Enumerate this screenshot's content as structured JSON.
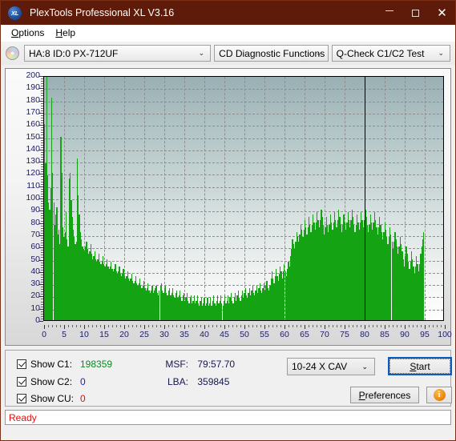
{
  "window": {
    "title": "PlexTools Professional XL V3.16",
    "app_icon": "xl-logo-icon",
    "minimize_label": "─",
    "maximize_label": "□",
    "close_label": "✕"
  },
  "menubar": {
    "items": [
      {
        "label": "Options",
        "accel": "O"
      },
      {
        "label": "Help",
        "accel": "H"
      }
    ]
  },
  "toolbar": {
    "disc_icon": "disc-icon",
    "drive_select": {
      "value": "HA:8 ID:0  PX-712UF",
      "arrow": "⌄"
    },
    "function_select": {
      "value": "CD Diagnostic Functions",
      "arrow": "⌄"
    },
    "test_select": {
      "value": "Q-Check C1/C2 Test",
      "arrow": "⌄"
    }
  },
  "controls": {
    "checks": [
      {
        "label": "Show C1:",
        "value": "198359",
        "color": "#0a8a22",
        "checked": true
      },
      {
        "label": "Show C2:",
        "value": "0",
        "color": "#1a1acc",
        "checked": true
      },
      {
        "label": "Show CU:",
        "value": "0",
        "color": "#d31414",
        "checked": true
      }
    ],
    "msf": {
      "key": "MSF:",
      "value": "79:57.70"
    },
    "lba": {
      "key": "LBA:",
      "value": "359845"
    },
    "speed_select": {
      "value": "10-24 X CAV",
      "arrow": "⌄"
    },
    "start_button": {
      "label": "Start",
      "accel": "S"
    },
    "preferences_button": {
      "label": "Preferences",
      "accel": "P"
    },
    "info_button": {
      "label": "i",
      "name": "info-icon"
    }
  },
  "statusbar": {
    "text": "Ready"
  },
  "chart_data": {
    "type": "area",
    "title": "",
    "xlabel": "",
    "ylabel": "",
    "xlim": [
      0,
      100
    ],
    "ylim": [
      0,
      200
    ],
    "x_ticks": [
      0,
      5,
      10,
      15,
      20,
      25,
      30,
      35,
      40,
      45,
      50,
      55,
      60,
      65,
      70,
      75,
      80,
      85,
      90,
      95,
      100
    ],
    "y_ticks": [
      0,
      10,
      20,
      30,
      40,
      50,
      60,
      70,
      80,
      90,
      100,
      110,
      120,
      130,
      140,
      150,
      160,
      170,
      180,
      190,
      200
    ],
    "grid": true,
    "legend": "none",
    "series_name": "C1 errors",
    "series_color": "#13a313",
    "data_end_marker_x": 80,
    "x_step": 0.25,
    "values": [
      160,
      128,
      200,
      118,
      96,
      90,
      108,
      182,
      120,
      96,
      78,
      86,
      92,
      70,
      74,
      62,
      150,
      120,
      76,
      68,
      72,
      88,
      66,
      60,
      116,
      120,
      98,
      84,
      74,
      68,
      62,
      64,
      132,
      102,
      86,
      72,
      66,
      60,
      58,
      56,
      60,
      64,
      58,
      54,
      56,
      62,
      54,
      50,
      52,
      56,
      50,
      48,
      50,
      54,
      48,
      46,
      48,
      52,
      46,
      44,
      46,
      50,
      44,
      42,
      44,
      48,
      42,
      40,
      42,
      46,
      40,
      38,
      40,
      44,
      38,
      36,
      38,
      42,
      36,
      34,
      36,
      40,
      34,
      32,
      34,
      38,
      32,
      30,
      32,
      36,
      30,
      28,
      30,
      34,
      28,
      26,
      28,
      32,
      26,
      24,
      26,
      30,
      24,
      22,
      24,
      28,
      22,
      24,
      26,
      28,
      22,
      20,
      24,
      28,
      30,
      24,
      22,
      26,
      28,
      22,
      20,
      24,
      26,
      20,
      22,
      26,
      20,
      18,
      22,
      24,
      18,
      20,
      24,
      18,
      16,
      20,
      22,
      16,
      18,
      22,
      16,
      14,
      18,
      20,
      14,
      16,
      20,
      14,
      16,
      20,
      14,
      12,
      16,
      18,
      12,
      14,
      18,
      12,
      14,
      18,
      12,
      14,
      18,
      12,
      16,
      20,
      14,
      12,
      16,
      20,
      14,
      16,
      20,
      14,
      12,
      16,
      20,
      14,
      16,
      20,
      14,
      18,
      22,
      16,
      14,
      18,
      22,
      16,
      20,
      24,
      18,
      16,
      20,
      24,
      18,
      22,
      26,
      20,
      18,
      22,
      26,
      20,
      24,
      28,
      22,
      20,
      24,
      28,
      22,
      26,
      30,
      24,
      22,
      26,
      30,
      24,
      28,
      32,
      26,
      24,
      28,
      34,
      40,
      34,
      30,
      36,
      42,
      36,
      32,
      38,
      44,
      40,
      34,
      40,
      46,
      40,
      36,
      42,
      48,
      44,
      52,
      58,
      66,
      62,
      58,
      64,
      72,
      68,
      64,
      70,
      78,
      74,
      68,
      74,
      82,
      76,
      70,
      76,
      84,
      78,
      72,
      78,
      86,
      80,
      74,
      80,
      88,
      82,
      76,
      82,
      90,
      84,
      78,
      70,
      76,
      84,
      78,
      72,
      78,
      86,
      80,
      74,
      80,
      88,
      82,
      76,
      82,
      90,
      84,
      78,
      72,
      78,
      86,
      80,
      74,
      80,
      88,
      82,
      76,
      82,
      90,
      84,
      78,
      72,
      78,
      86,
      80,
      74,
      80,
      88,
      82,
      76,
      82,
      90,
      84,
      78,
      72,
      78,
      86,
      80,
      74,
      80,
      88,
      82,
      76,
      70,
      76,
      84,
      78,
      72,
      66,
      72,
      80,
      74,
      68,
      62,
      68,
      76,
      70,
      64,
      58,
      64,
      72,
      66,
      60,
      54,
      60,
      68,
      62,
      56,
      50,
      44,
      52,
      60,
      54,
      48,
      42,
      48,
      56,
      50,
      44,
      38,
      44,
      52,
      46,
      40,
      46,
      54,
      60,
      66,
      72,
      0,
      0,
      0,
      0,
      0,
      0,
      0,
      0,
      0,
      0,
      0,
      0,
      0,
      0,
      0,
      0,
      0,
      0,
      0,
      0
    ]
  }
}
